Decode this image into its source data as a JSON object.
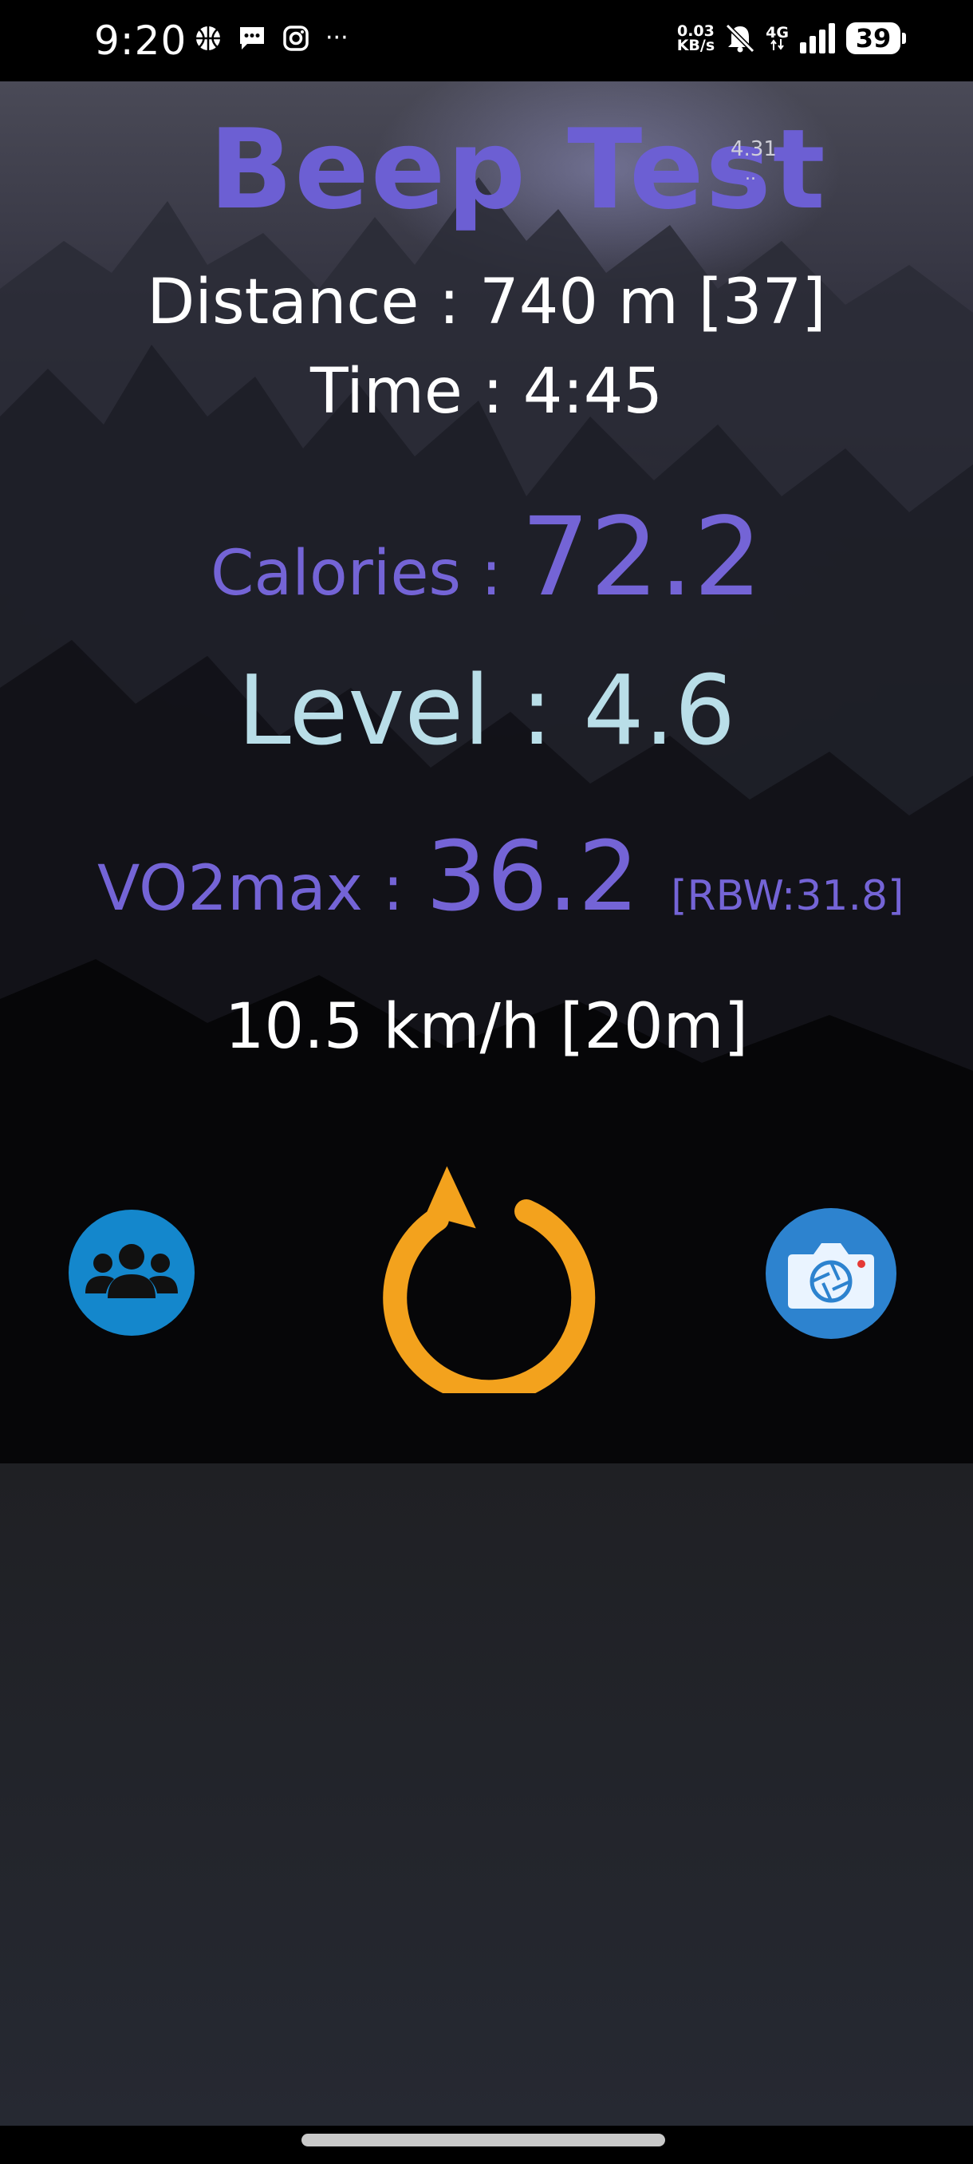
{
  "status_bar": {
    "time": "9:20",
    "net_speed_value": "0.03",
    "net_speed_unit": "KB/s",
    "network_type": "4G",
    "battery": "39",
    "more_icons": "···"
  },
  "app": {
    "title": "Beep Test",
    "version": "4.31",
    "version_dots": ".."
  },
  "stats": {
    "distance": "Distance : 740 m [37]",
    "time": "Time : 4:45",
    "calories_label": "Calories :",
    "calories_value": "72.2",
    "level": "Level : 4.6",
    "vo2_label": "VO2max :",
    "vo2_value": "36.2",
    "rbw": "[RBW:31.8]",
    "speed": "10.5 km/h [20m]"
  },
  "buttons": {
    "group_icon": "group-icon",
    "reset_icon": "refresh-icon",
    "camera_icon": "camera-icon"
  },
  "colors": {
    "accent_purple": "#6c5fd3",
    "level_blue": "#b9dee8",
    "reset_orange": "#f3a21d",
    "group_blue": "#1487cc"
  }
}
